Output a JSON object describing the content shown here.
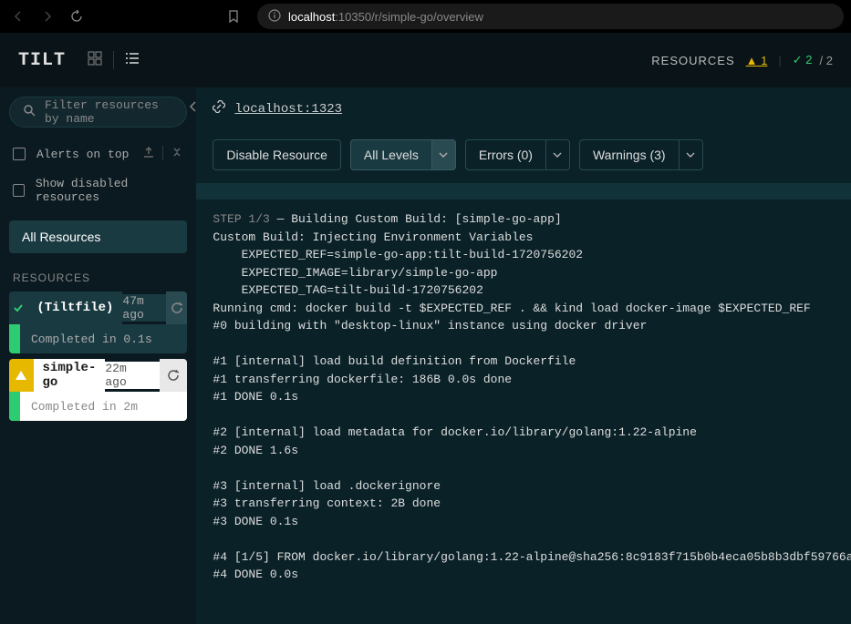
{
  "browser": {
    "host": "localhost",
    "path": ":10350/r/simple-go/overview"
  },
  "header": {
    "logo": "TILT",
    "resources_label": "RESOURCES",
    "warning_triangle": "▲",
    "warning_count": "1",
    "ok_mark": "✓",
    "ok_count": "2",
    "ok_total": "/ 2"
  },
  "sidebar": {
    "filter_placeholder": "Filter resources by name",
    "alerts_on_top": "Alerts on top",
    "show_disabled": "Show disabled resources",
    "all_resources": "All Resources",
    "section": "RESOURCES",
    "items": [
      {
        "name": "(Tiltfile)",
        "time": "47m ago",
        "detail": "Completed in 0.1s"
      },
      {
        "name": "simple-go",
        "time": "22m ago",
        "detail": "Completed in 2m"
      }
    ]
  },
  "content": {
    "endpoint": "localhost:1323",
    "disable_btn": "Disable Resource",
    "levels_btn": "All Levels",
    "errors_btn": "Errors (0)",
    "warnings_btn": "Warnings (3)"
  },
  "log": {
    "step_prefix": "STEP 1/3",
    "step_title": " — Building Custom Build: [simple-go-app]",
    "lines": [
      "Custom Build: Injecting Environment Variables",
      "    EXPECTED_REF=simple-go-app:tilt-build-1720756202",
      "    EXPECTED_IMAGE=library/simple-go-app",
      "    EXPECTED_TAG=tilt-build-1720756202",
      "Running cmd: docker build -t $EXPECTED_REF . && kind load docker-image $EXPECTED_REF",
      "#0 building with \"desktop-linux\" instance using docker driver",
      "",
      "#1 [internal] load build definition from Dockerfile",
      "#1 transferring dockerfile: 186B 0.0s done",
      "#1 DONE 0.1s",
      "",
      "#2 [internal] load metadata for docker.io/library/golang:1.22-alpine",
      "#2 DONE 1.6s",
      "",
      "#3 [internal] load .dockerignore",
      "#3 transferring context: 2B done",
      "#3 DONE 0.1s",
      "",
      "#4 [1/5] FROM docker.io/library/golang:1.22-alpine@sha256:8c9183f715b0b4eca05b8b3dbf59766a",
      "#4 DONE 0.0s"
    ]
  }
}
